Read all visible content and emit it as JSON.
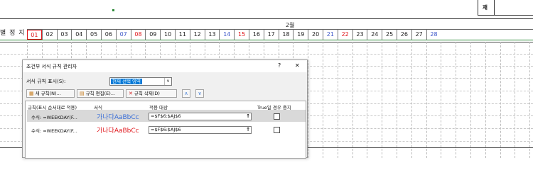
{
  "sheet": {
    "header_cell": "재",
    "side_label": "별 정 지",
    "month": "2월",
    "days": [
      "01",
      "02",
      "03",
      "04",
      "05",
      "06",
      "07",
      "08",
      "09",
      "10",
      "11",
      "12",
      "13",
      "14",
      "15",
      "16",
      "17",
      "18",
      "19",
      "20",
      "21",
      "22",
      "23",
      "24",
      "25",
      "26",
      "27",
      "28"
    ],
    "day_colors": {
      "red": "#e0161b",
      "blue": "#3b55c8"
    }
  },
  "dialog": {
    "title": "조건부 서식 규칙 관리자",
    "help_button": "?",
    "close_button": "✕",
    "show_rules_label": "서식 규칙 표시(S):",
    "show_rules_value": "현재 선택 영역",
    "buttons": {
      "new_rule": "새 규칙(N)...",
      "edit_rule": "규칙 편집(E)...",
      "delete_rule": "규칙 삭제(D)",
      "move_up": "∧",
      "move_down": "∨"
    },
    "columns": {
      "rule": "규칙(표시 순서대로 적용)",
      "format": "서식",
      "applies_to": "적용 대상",
      "stop_if_true": "True일 경우 중지"
    },
    "rules": [
      {
        "rule": "수식: =WEEKDAY(F...",
        "preview": "가나다AaBbCc",
        "preview_color": "#3b6fd8",
        "applies_to": "=$F$6:$AJ$6",
        "stop_if_true": false
      },
      {
        "rule": "수식: =WEEKDAY(F...",
        "preview": "가나다AaBbCc",
        "preview_color": "#e0161b",
        "applies_to": "=$F$6:$AJ$6",
        "stop_if_true": false
      }
    ]
  }
}
